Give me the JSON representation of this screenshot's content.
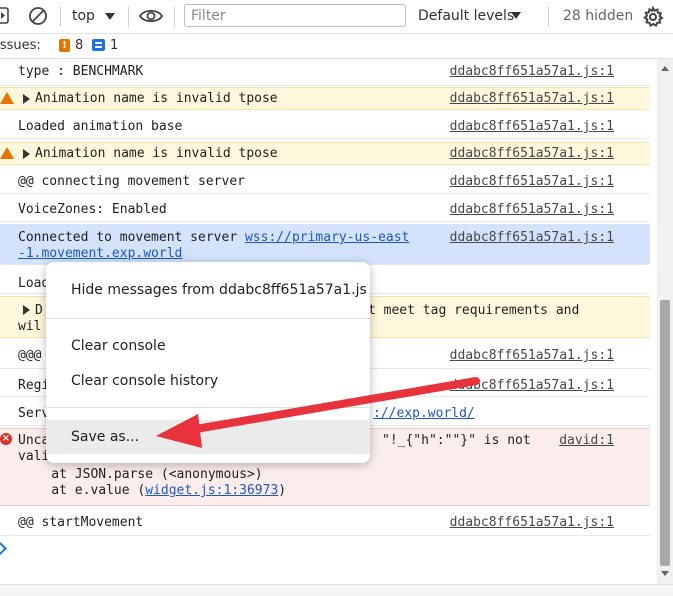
{
  "toolbar": {
    "context": "top",
    "filter_placeholder": "Filter",
    "levels": "Default levels",
    "hidden_count": "28 hidden"
  },
  "issues": {
    "label": "Issues:",
    "warning_count": "8",
    "info_count": "1"
  },
  "console": {
    "rows": [
      {
        "text": "type : BENCHMARK",
        "source": "ddabc8ff651a57a1.js:1"
      },
      {
        "text": "Animation name is invalid tpose",
        "source": "ddabc8ff651a57a1.js:1"
      },
      {
        "text": "Loaded animation base",
        "source": "ddabc8ff651a57a1.js:1"
      },
      {
        "text": "Animation name is invalid tpose",
        "source": "ddabc8ff651a57a1.js:1"
      },
      {
        "text": "@@ connecting movement server",
        "source": "ddabc8ff651a57a1.js:1"
      },
      {
        "text": "VoiceZones: Enabled",
        "source": "ddabc8ff651a57a1.js:1"
      },
      {
        "text": "Connected to movement server ",
        "link1": "wss://primary-us-east",
        "link2": "-1.movement.exp.world",
        "source": "ddabc8ff651a57a1.js:1"
      },
      {
        "text": "Load"
      },
      {
        "text": "D",
        "text_right": "t meet tag requirements and",
        "text2": "wil"
      },
      {
        "text": "@@@",
        "source": "ddabc8ff651a57a1.js:1"
      },
      {
        "text": "Regi",
        "source": "ddabc8ff651a57a1.js:1"
      },
      {
        "text": "Serv",
        "link": "://exp.world/"
      },
      {
        "text": "Unca",
        "text_right": "\"!_{\"h\":\"\"}\" is not",
        "text2": "vali",
        "stack1": "    at JSON.parse (<anonymous>)",
        "stack2_prefix": "    at e.value (",
        "stack2_link": "widget.js:1:36973",
        "stack2_suffix": ")",
        "source": "david:1"
      },
      {
        "text": "@@ startMovement",
        "source": "ddabc8ff651a57a1.js:1"
      }
    ]
  },
  "context_menu": {
    "items": [
      "Hide messages from ddabc8ff651a57a1.js",
      "Clear console",
      "Clear console history",
      "Save as..."
    ]
  },
  "colors": {
    "annotation_arrow": "#e8333c",
    "warning_icon": "#e37400",
    "error_icon": "#d93025",
    "link": "#1a57c7"
  }
}
